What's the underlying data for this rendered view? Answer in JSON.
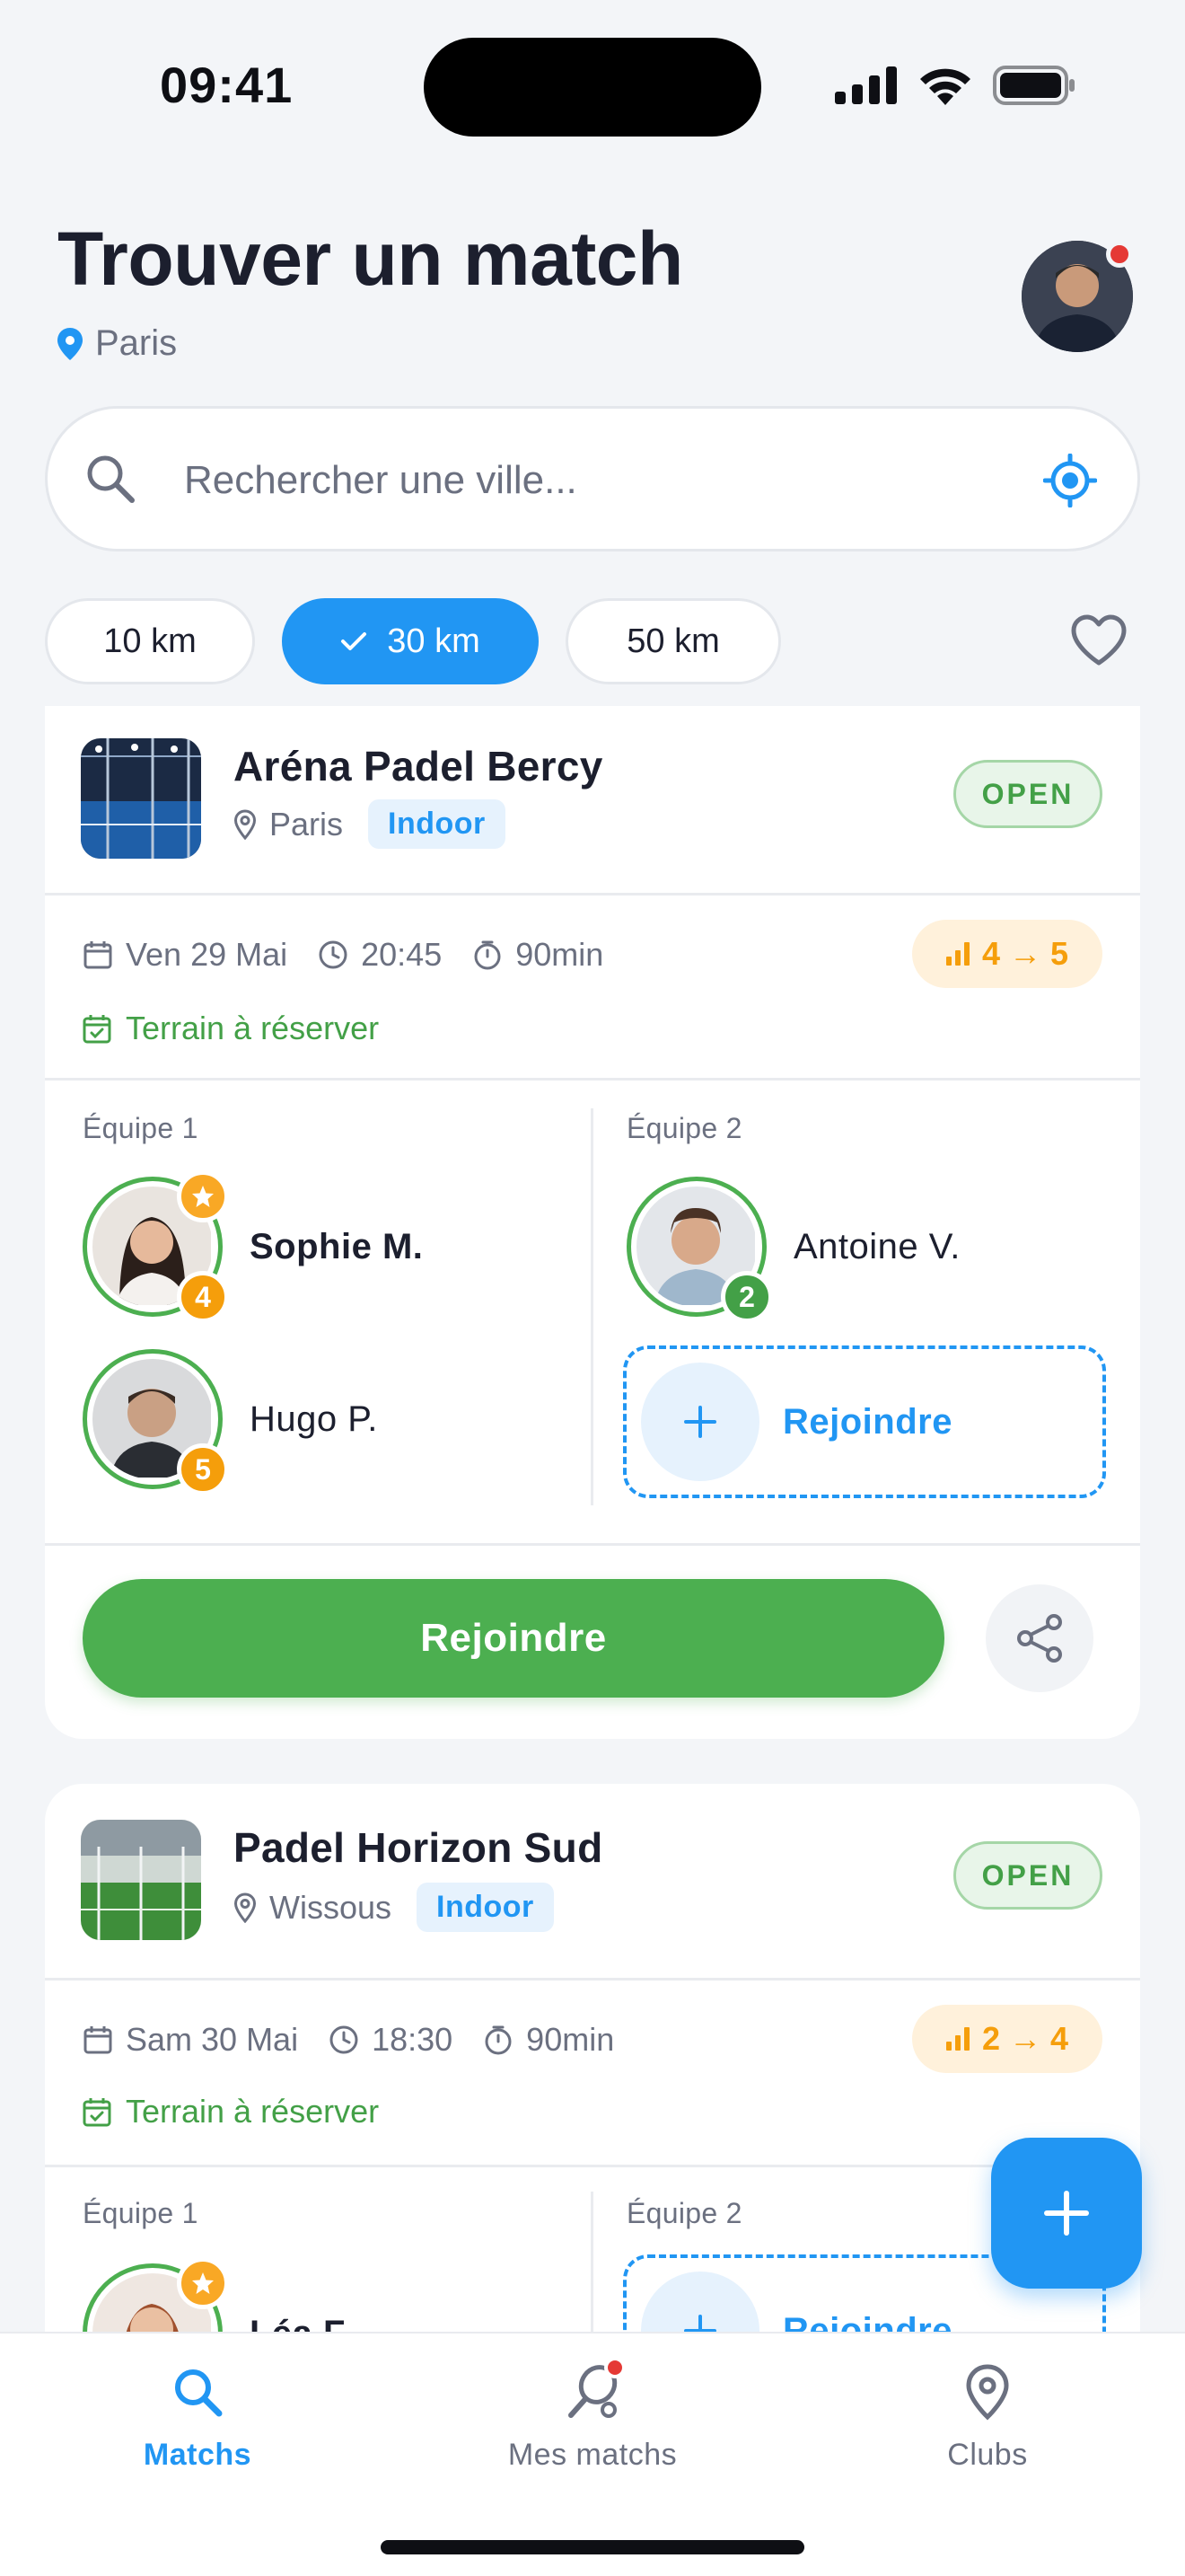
{
  "status_bar": {
    "time": "09:41"
  },
  "header": {
    "title": "Trouver un match",
    "location": "Paris"
  },
  "search": {
    "placeholder": "Rechercher une ville..."
  },
  "distance_chips": [
    {
      "label": "10 km",
      "selected": false
    },
    {
      "label": "30 km",
      "selected": true
    },
    {
      "label": "50 km",
      "selected": false
    }
  ],
  "colors": {
    "accent": "#2196f3",
    "success": "#4caf50",
    "warning": "#f59e0b",
    "danger": "#e53935"
  },
  "matches": [
    {
      "club": "Aréna Padel Bercy",
      "city": "Paris",
      "type": "Indoor",
      "status": "OPEN",
      "date": "Ven 29 Mai",
      "time": "20:45",
      "duration": "90min",
      "level_range": "4 → 5",
      "terrain": "Terrain à réserver",
      "team1_label": "Équipe 1",
      "team2_label": "Équipe 2",
      "team1": [
        {
          "name": "Sophie M.",
          "level": "4",
          "captain": true
        },
        {
          "name": "Hugo P.",
          "level": "5",
          "captain": false
        }
      ],
      "team2": [
        {
          "name": "Antoine V.",
          "level": "2",
          "captain": false
        }
      ],
      "join_slot_label": "Rejoindre",
      "join_button": "Rejoindre"
    },
    {
      "club": "Padel Horizon Sud",
      "city": "Wissous",
      "type": "Indoor",
      "status": "OPEN",
      "date": "Sam 30 Mai",
      "time": "18:30",
      "duration": "90min",
      "level_range": "2 → 4",
      "terrain": "Terrain à réserver",
      "team1_label": "Équipe 1",
      "team2_label": "Équipe 2",
      "team1": [
        {
          "name": "Léa F.",
          "captain": true
        }
      ],
      "join_slot_label": "Rejoindre"
    }
  ],
  "bottom_nav": [
    {
      "label": "Matchs",
      "icon": "search-icon",
      "active": true
    },
    {
      "label": "Mes matchs",
      "icon": "racket-icon",
      "active": false,
      "badge": true
    },
    {
      "label": "Clubs",
      "icon": "map-pin-icon",
      "active": false
    }
  ]
}
